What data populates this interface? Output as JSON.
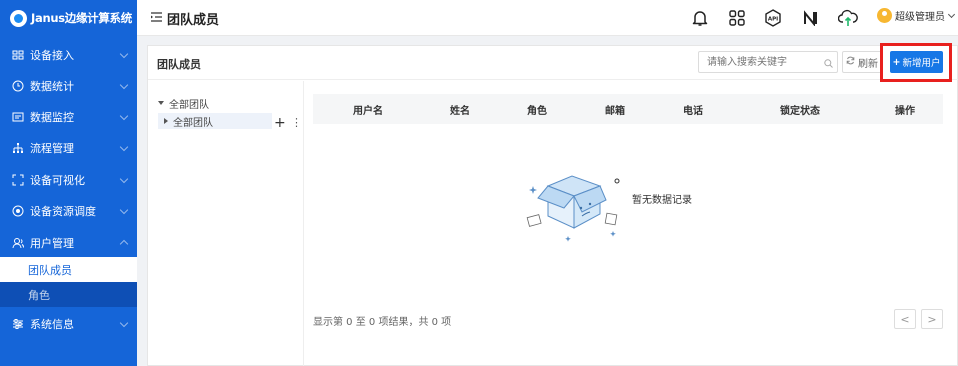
{
  "app": {
    "title": "Janus边缘计算系统"
  },
  "sidebar": {
    "items": [
      {
        "label": "设备接入",
        "icon": "device-icon"
      },
      {
        "label": "数据统计",
        "icon": "clock-icon"
      },
      {
        "label": "数据监控",
        "icon": "monitor-icon"
      },
      {
        "label": "流程管理",
        "icon": "flow-icon"
      },
      {
        "label": "设备可视化",
        "icon": "visual-icon"
      },
      {
        "label": "设备资源调度",
        "icon": "target-icon"
      },
      {
        "label": "用户管理",
        "icon": "users-icon"
      },
      {
        "label": "系统信息",
        "icon": "settings-sliders-icon"
      }
    ],
    "subitems": [
      {
        "label": "团队成员",
        "active": true
      },
      {
        "label": "角色",
        "active": false
      }
    ]
  },
  "header": {
    "title": "团队成员",
    "icons": [
      "bell-icon",
      "apps-icon",
      "api-icon",
      "n-logo-icon",
      "cloud-upload-icon"
    ],
    "api_label": "API",
    "user_name": "超级管理员"
  },
  "card": {
    "title": "团队成员",
    "search_placeholder": "请输入搜索关键字",
    "refresh_label": "刷新",
    "add_label": "新增用户"
  },
  "tree": {
    "root": "全部团队",
    "child": "全部团队"
  },
  "table": {
    "columns": [
      "用户名",
      "姓名",
      "角色",
      "邮箱",
      "电话",
      "锁定状态",
      "操作"
    ],
    "empty_text": "暂无数据记录",
    "footer": "显示第 0 至 0 项结果，共 0 项",
    "prev": "<",
    "next": ">"
  },
  "colors": {
    "sidebar": "#1565d8",
    "primary": "#1677e6",
    "highlight": "#e8201e"
  }
}
